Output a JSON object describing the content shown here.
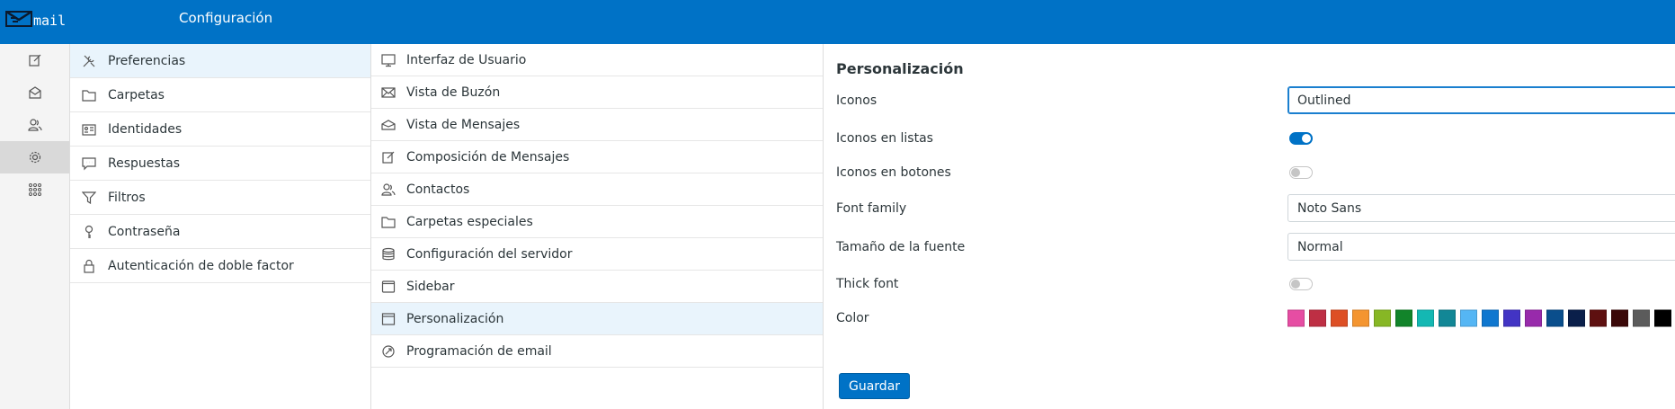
{
  "header": {
    "logo_text": "mail",
    "title": "Configuración"
  },
  "rail": [
    {
      "icon": "compose-icon"
    },
    {
      "icon": "mail-icon"
    },
    {
      "icon": "contacts-icon"
    },
    {
      "icon": "gear-icon",
      "active": true
    },
    {
      "icon": "apps-grid-icon"
    }
  ],
  "settings_sections": [
    {
      "label": "Preferencias",
      "icon": "tools-icon",
      "selected": true
    },
    {
      "label": "Carpetas",
      "icon": "folder-icon"
    },
    {
      "label": "Identidades",
      "icon": "id-card-icon"
    },
    {
      "label": "Respuestas",
      "icon": "comment-icon"
    },
    {
      "label": "Filtros",
      "icon": "filter-icon"
    },
    {
      "label": "Contraseña",
      "icon": "key-icon"
    },
    {
      "label": "Autenticación de doble factor",
      "icon": "lock-icon"
    }
  ],
  "preference_sections": [
    {
      "label": "Interfaz de Usuario",
      "icon": "monitor-icon"
    },
    {
      "label": "Vista de Buzón",
      "icon": "envelope-icon"
    },
    {
      "label": "Vista de Mensajes",
      "icon": "envelope-open-icon"
    },
    {
      "label": "Composición de Mensajes",
      "icon": "compose-icon"
    },
    {
      "label": "Contactos",
      "icon": "contacts-icon"
    },
    {
      "label": "Carpetas especiales",
      "icon": "folder-icon"
    },
    {
      "label": "Configuración del servidor",
      "icon": "database-icon"
    },
    {
      "label": "Sidebar",
      "icon": "sidebar-icon"
    },
    {
      "label": "Personalización",
      "icon": "window-icon",
      "selected": true
    },
    {
      "label": "Programación de email",
      "icon": "schedule-icon"
    }
  ],
  "panel": {
    "title": "Personalización",
    "icons": {
      "label": "Iconos",
      "value": "Outlined"
    },
    "icons_in_lists": {
      "label": "Iconos en listas",
      "on": true
    },
    "icons_in_buttons": {
      "label": "Iconos en botones",
      "on": false
    },
    "font_family": {
      "label": "Font family",
      "value": "Noto Sans"
    },
    "font_size": {
      "label": "Tamaño de la fuente",
      "value": "Normal"
    },
    "thick_font": {
      "label": "Thick font",
      "on": false
    },
    "color": {
      "label": "Color",
      "swatches": [
        "#e64da3",
        "#be2f44",
        "#dd4f25",
        "#f49530",
        "#87b725",
        "#12842a",
        "#14b8b3",
        "#128796",
        "#55b6f4",
        "#0f77cf",
        "#4234c4",
        "#982aab",
        "#0a4e8c",
        "#0a1f4a",
        "#5e1010",
        "#3a0808",
        "#5b5b5b",
        "#000000"
      ]
    },
    "save_label": "Guardar"
  }
}
